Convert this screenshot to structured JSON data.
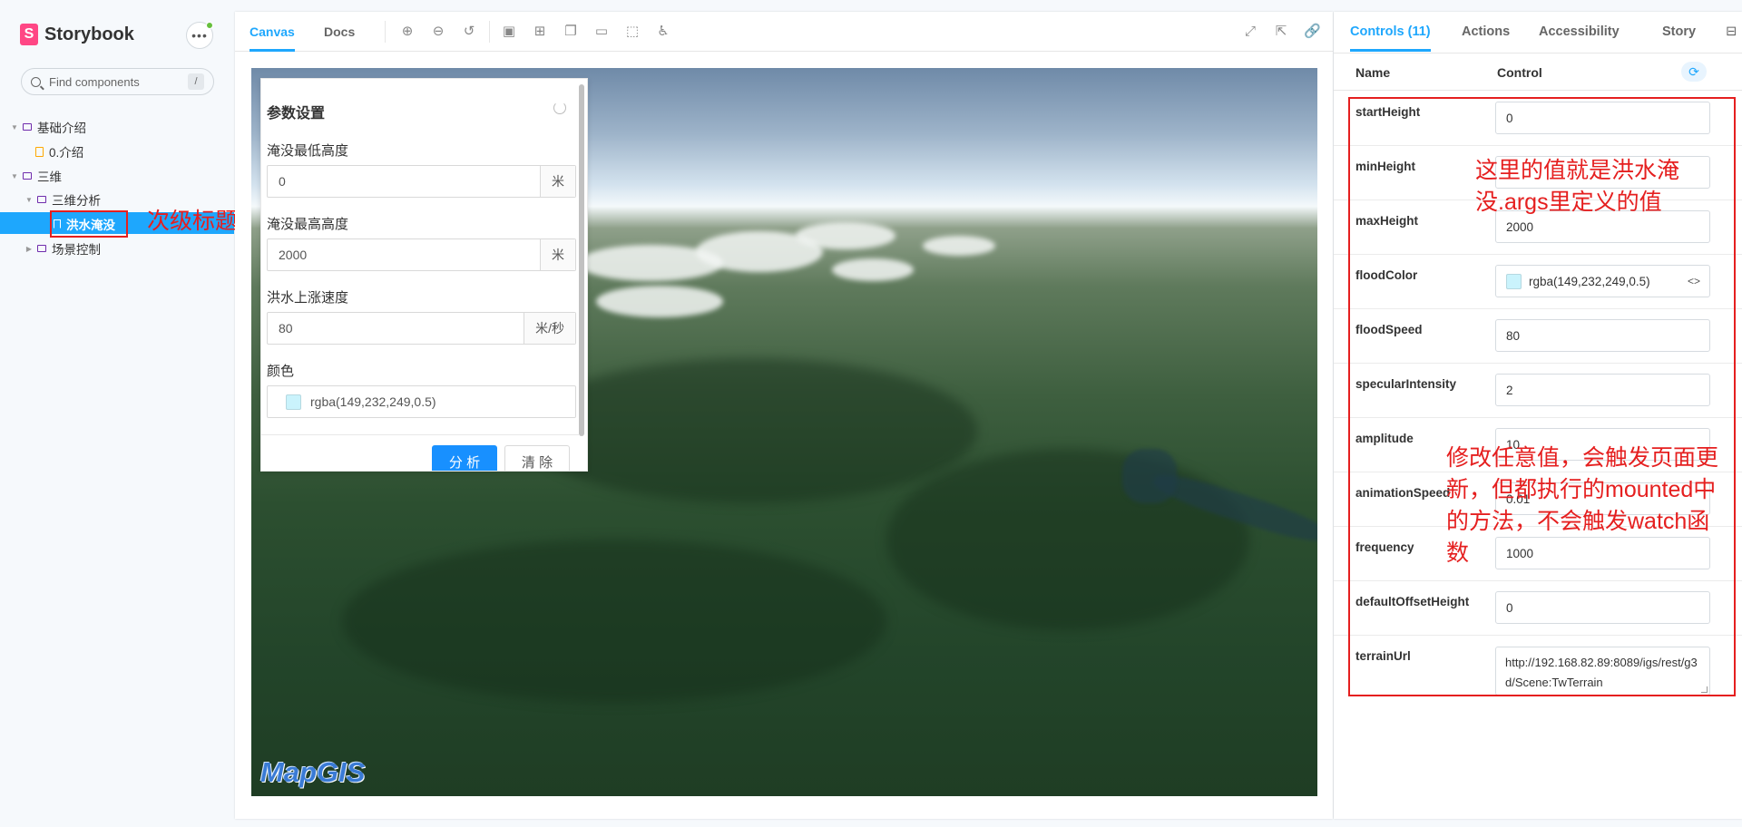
{
  "sidebar": {
    "brand": "Storybook",
    "search_placeholder": "Find components",
    "search_shortcut": "/",
    "tree": {
      "group1": "基础介绍",
      "intro": "0.介绍",
      "group2": "三维",
      "sub_analysis": "三维分析",
      "selected": "洪水淹没",
      "scene_control": "场景控制"
    },
    "annotation": "次级标题名称"
  },
  "preview": {
    "tabs": [
      "Canvas",
      "Docs"
    ],
    "params": {
      "title": "参数设置",
      "min_label": "淹没最低高度",
      "min_value": "0",
      "min_unit": "米",
      "max_label": "淹没最高高度",
      "max_value": "2000",
      "max_unit": "米",
      "speed_label": "洪水上涨速度",
      "speed_value": "80",
      "speed_unit": "米/秒",
      "color_label": "颜色",
      "color_value": "rgba(149,232,249,0.5)",
      "analyze_button": "分 析",
      "clear_button": "清 除"
    },
    "watermark": "MapGIS"
  },
  "addons": {
    "tabs": [
      "Controls (11)",
      "Actions",
      "Accessibility",
      "Story"
    ],
    "header": {
      "name": "Name",
      "control": "Control"
    },
    "rows": [
      {
        "name": "startHeight",
        "value": "0"
      },
      {
        "name": "minHeight",
        "value": ""
      },
      {
        "name": "maxHeight",
        "value": "2000"
      },
      {
        "name": "floodColor",
        "value": "rgba(149,232,249,0.5)"
      },
      {
        "name": "floodSpeed",
        "value": "80"
      },
      {
        "name": "specularIntensity",
        "value": "2"
      },
      {
        "name": "amplitude",
        "value": "10"
      },
      {
        "name": "animationSpeed",
        "value": "0.01"
      },
      {
        "name": "frequency",
        "value": "1000"
      },
      {
        "name": "defaultOffsetHeight",
        "value": "0"
      },
      {
        "name": "terrainUrl",
        "value": "http://192.168.82.89:8089/igs/rest/g3d/Scene:TwTerrain"
      }
    ],
    "annotation_top": "这里的值就是洪水淹没.args里定义的值",
    "annotation_bottom": "修改任意值，会触发页面更新，但都执行的mounted中的方法，不会触发watch函数"
  },
  "colors": {
    "accent": "#1ea7fd",
    "annotation_red": "#e51f1f",
    "primary_button": "#1890ff",
    "brand_pink": "#ff4785"
  }
}
